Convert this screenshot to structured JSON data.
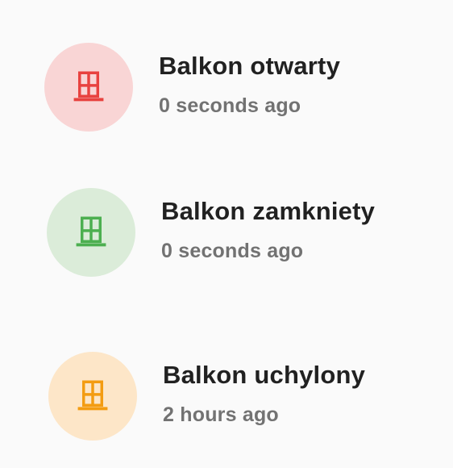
{
  "items": [
    {
      "name": "Balkon otwarty",
      "time": "0 seconds ago",
      "icon": "window-icon",
      "icon_color": "#e8423f",
      "badge_color": "#f9d5d5"
    },
    {
      "name": "Balkon zamkniety",
      "time": "0 seconds ago",
      "icon": "window-icon",
      "icon_color": "#4caf50",
      "badge_color": "#dbecd9"
    },
    {
      "name": "Balkon uchylony",
      "time": "2 hours ago",
      "icon": "window-icon",
      "icon_color": "#f39c12",
      "badge_color": "#fde6c8"
    }
  ]
}
